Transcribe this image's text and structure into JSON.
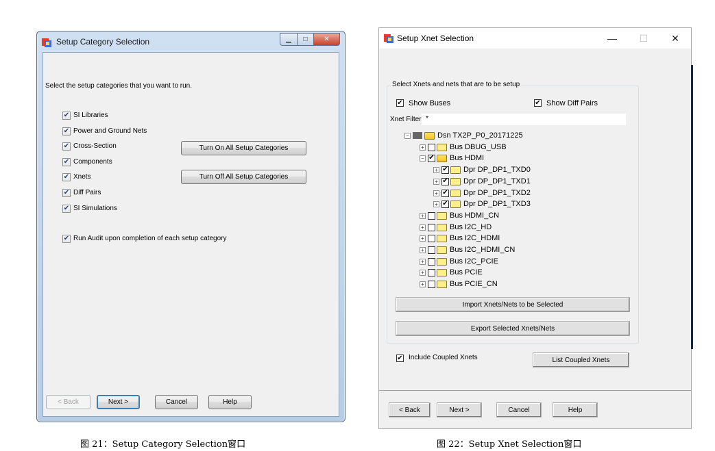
{
  "left_window": {
    "title": "Setup Category Selection",
    "intro": "Select the setup categories that you want to run.",
    "categories": [
      {
        "label": "SI Libraries",
        "checked": true
      },
      {
        "label": "Power and Ground Nets",
        "checked": true
      },
      {
        "label": "Cross-Section",
        "checked": true
      },
      {
        "label": "Components",
        "checked": true
      },
      {
        "label": "Xnets",
        "checked": true
      },
      {
        "label": "Diff Pairs",
        "checked": true
      },
      {
        "label": "SI Simulations",
        "checked": true
      }
    ],
    "turn_on_all": "Turn On All Setup Categories",
    "turn_off_all": "Turn Off All Setup Categories",
    "run_audit": {
      "label": "Run Audit upon completion of each setup category",
      "checked": true
    },
    "buttons": {
      "back": "< Back",
      "next": "Next >",
      "cancel": "Cancel",
      "help": "Help"
    }
  },
  "right_window": {
    "title": "Setup Xnet Selection",
    "group_label": "Select Xnets and nets that are to be setup",
    "show_buses": {
      "label": "Show Buses",
      "checked": true
    },
    "show_diff_pairs": {
      "label": "Show Diff Pairs",
      "checked": true
    },
    "filter_label": "Xnet Filter:",
    "filter_value": "*",
    "tree": [
      {
        "label": "Dsn TX2P_P0_20171225",
        "level": 0,
        "expander": "-",
        "checked": null,
        "folder": "open"
      },
      {
        "label": "Bus DBUG_USB",
        "level": 1,
        "expander": "+",
        "checked": false,
        "folder": "closed"
      },
      {
        "label": "Bus HDMI",
        "level": 1,
        "expander": "-",
        "checked": true,
        "folder": "open"
      },
      {
        "label": "Dpr DP_DP1_TXD0",
        "level": 2,
        "expander": "+",
        "checked": true,
        "folder": "closed"
      },
      {
        "label": "Dpr DP_DP1_TXD1",
        "level": 2,
        "expander": "+",
        "checked": true,
        "folder": "closed"
      },
      {
        "label": "Dpr DP_DP1_TXD2",
        "level": 2,
        "expander": "+",
        "checked": true,
        "folder": "closed"
      },
      {
        "label": "Dpr DP_DP1_TXD3",
        "level": 2,
        "expander": "+",
        "checked": true,
        "folder": "closed"
      },
      {
        "label": "Bus HDMI_CN",
        "level": 1,
        "expander": "+",
        "checked": false,
        "folder": "closed"
      },
      {
        "label": "Bus I2C_HD",
        "level": 1,
        "expander": "+",
        "checked": false,
        "folder": "closed"
      },
      {
        "label": "Bus I2C_HDMI",
        "level": 1,
        "expander": "+",
        "checked": false,
        "folder": "closed"
      },
      {
        "label": "Bus I2C_HDMI_CN",
        "level": 1,
        "expander": "+",
        "checked": false,
        "folder": "closed"
      },
      {
        "label": "Bus I2C_PCIE",
        "level": 1,
        "expander": "+",
        "checked": false,
        "folder": "closed"
      },
      {
        "label": "Bus PCIE",
        "level": 1,
        "expander": "+",
        "checked": false,
        "folder": "closed"
      },
      {
        "label": "Bus PCIE_CN",
        "level": 1,
        "expander": "+",
        "checked": false,
        "folder": "closed"
      }
    ],
    "import_button": "Import Xnets/Nets to be Selected",
    "export_button": "Export Selected Xnets/Nets",
    "include_coupled": {
      "label": "Include Coupled Xnets",
      "checked": true
    },
    "list_coupled": "List Coupled Xnets",
    "buttons": {
      "back": "< Back",
      "next": "Next >",
      "cancel": "Cancel",
      "help": "Help"
    },
    "title_buttons": {
      "minimize": "—",
      "maximize": "☐",
      "close": "✕"
    }
  },
  "captions": {
    "left": "图 21：Setup Category Selection窗口",
    "right": "图 22：Setup Xnet Selection窗口"
  },
  "colors": {
    "win7_frame": "#b7cde6",
    "win7_close": "#c8402a",
    "dialog_bg": "#f0f0f0"
  }
}
